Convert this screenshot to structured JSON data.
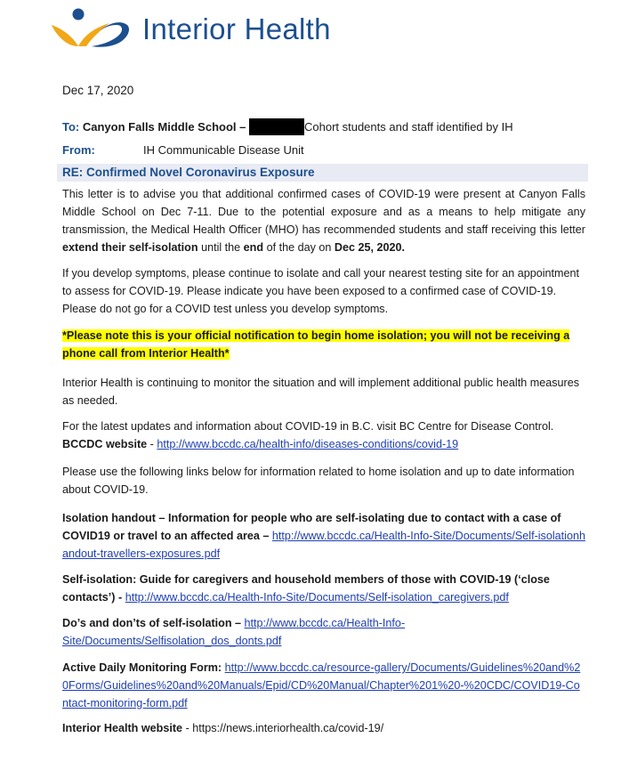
{
  "header": {
    "org_name": "Interior Health",
    "logo_colors": {
      "blue": "#1c4f8f",
      "gold": "#f0a818"
    }
  },
  "letter": {
    "date": "Dec 17, 2020",
    "to_label": "To:",
    "to_value": "Canyon Falls Middle School –",
    "to_suffix": "Cohort students and staff identified by IH",
    "from_label": "From:",
    "from_value": "IH Communicable Disease Unit",
    "re": "RE: Confirmed Novel Coronavirus Exposure",
    "para1": "This letter is to advise you that additional confirmed cases of COVID-19 were present at Canyon Falls Middle School on Dec 7-11. Due to the potential exposure and as a means to help mitigate any transmission, the Medical Health Officer (MHO) has recommended students and staff receiving this letter",
    "para1_bold1": "extend their self-isolation",
    "para1_mid": "until the",
    "para1_bold2": "end",
    "para1_mid2": "of the day on",
    "para1_bold3": "Dec 25, 2020.",
    "para2": "If you develop symptoms, please continue to isolate and call your nearest testing site for an appointment to assess for COVID-19. Please indicate you have been exposed to a confirmed case of COVID-19. Please do not go for a COVID test unless you develop symptoms.",
    "notice": "*Please note this is your official notification to begin home isolation; you will not be receiving a phone call from Interior Health*",
    "para3": "Interior Health is continuing to monitor the situation and will implement additional public health measures as needed.",
    "para4": "For the latest updates and information about COVID-19 in B.C. visit BC Centre for Disease Control.",
    "bccdc_label": "BCCDC website",
    "bccdc_url": "http://www.bccdc.ca/health-info/diseases-conditions/covid-19",
    "para5": "Please use the following links below for information related to home isolation and up to date information about COVID-19.",
    "links": [
      {
        "label": "Isolation handout – Information for people who are self-isolating due to contact with a case of COVID19 or travel to an affected area –",
        "url": "http://www.bccdc.ca/Health-Info-Site/Documents/Self-isolationhandout-travellers-exposures.pdf"
      },
      {
        "label": "Self-isolation: Guide for caregivers and household members of those with COVID-19 (‘close contacts’) -",
        "url": "http://www.bccdc.ca/Health-Info-Site/Documents/Self-isolation_caregivers.pdf"
      },
      {
        "label": "Do’s and don’ts of self-isolation –",
        "url": "http://www.bccdc.ca/Health-Info-Site/Documents/Selfisolation_dos_donts.pdf"
      },
      {
        "label": "Active Daily Monitoring Form:",
        "url": "http://www.bccdc.ca/resource-gallery/Documents/Guidelines%20and%20Forms/Guidelines%20and%20Manuals/Epid/CD%20Manual/Chapter%201%20-%20CDC/COVID19-Contact-monitoring-form.pdf"
      }
    ],
    "ih_label": "Interior Health website",
    "ih_url": "https://news.interiorhealth.ca/covid-19/"
  }
}
